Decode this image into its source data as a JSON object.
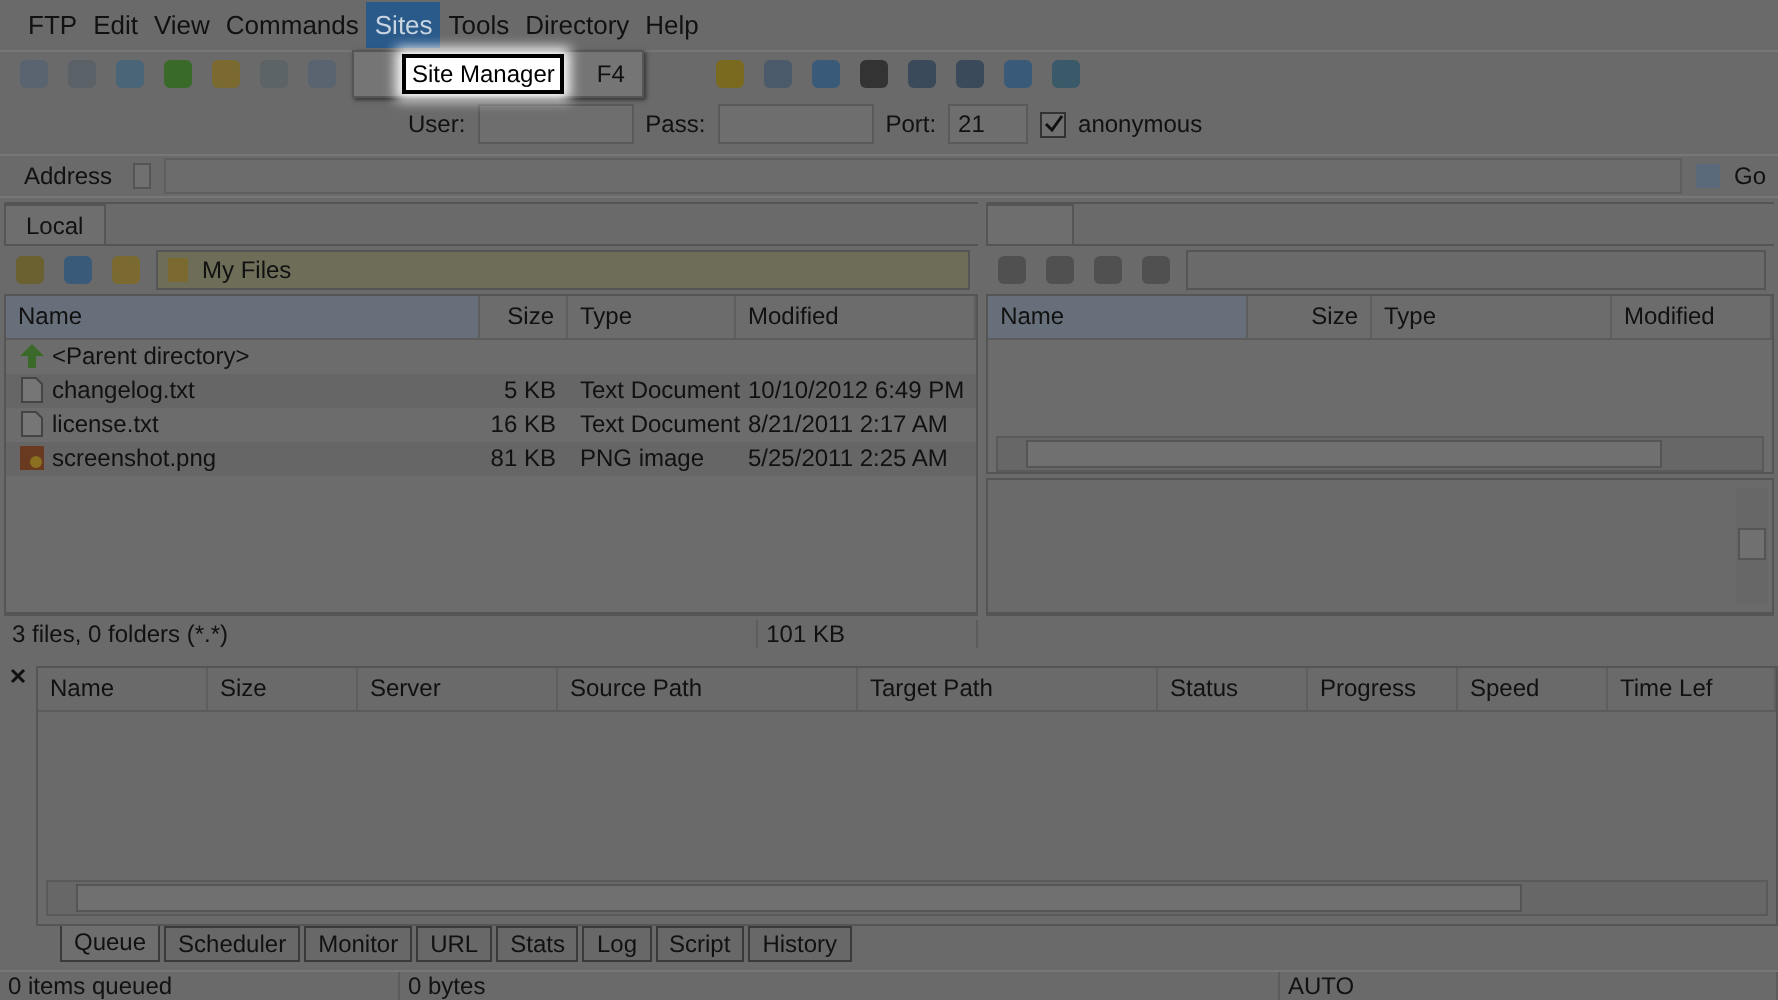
{
  "menu": [
    {
      "label": "FTP",
      "selected": false
    },
    {
      "label": "Edit",
      "selected": false
    },
    {
      "label": "View",
      "selected": false
    },
    {
      "label": "Commands",
      "selected": false
    },
    {
      "label": "Sites",
      "selected": true
    },
    {
      "label": "Tools",
      "selected": false
    },
    {
      "label": "Directory",
      "selected": false
    },
    {
      "label": "Help",
      "selected": false
    }
  ],
  "menu_popup": {
    "items": [
      {
        "label": "Site Manager",
        "shortcut": "F4",
        "selected": true
      }
    ]
  },
  "connection": {
    "user_label": "User:",
    "pass_label": "Pass:",
    "port_label": "Port:",
    "port": "21",
    "anonymous_label": "anonymous",
    "anonymous": true
  },
  "address": {
    "label": "Address",
    "go": "Go"
  },
  "local": {
    "tab": "Local",
    "path": "My Files",
    "columns": [
      "Name",
      "Size",
      "Type",
      "Modified"
    ],
    "rows": [
      {
        "kind": "parent",
        "name": "<Parent directory>",
        "size": "",
        "type": "",
        "modified": ""
      },
      {
        "kind": "text",
        "name": "changelog.txt",
        "size": "5 KB",
        "type": "Text Document",
        "modified": "10/10/2012 6:49 PM"
      },
      {
        "kind": "text",
        "name": "license.txt",
        "size": "16 KB",
        "type": "Text Document",
        "modified": "8/21/2011 2:17 AM"
      },
      {
        "kind": "image",
        "name": "screenshot.png",
        "size": "81 KB",
        "type": "PNG image",
        "modified": "5/25/2011 2:25 AM"
      }
    ],
    "status": "3 files, 0 folders (*.*)",
    "total": "101 KB"
  },
  "remote": {
    "columns": [
      "Name",
      "Size",
      "Type",
      "Modified"
    ]
  },
  "queue": {
    "columns": [
      "Name",
      "Size",
      "Server",
      "Source Path",
      "Target Path",
      "Status",
      "Progress",
      "Speed",
      "Time Lef"
    ],
    "tabs": [
      {
        "label": "Queue",
        "selected": true
      },
      {
        "label": "Scheduler",
        "selected": false
      },
      {
        "label": "Monitor",
        "selected": false
      },
      {
        "label": "URL",
        "selected": false
      },
      {
        "label": "Stats",
        "selected": false
      },
      {
        "label": "Log",
        "selected": false
      },
      {
        "label": "Script",
        "selected": false
      },
      {
        "label": "History",
        "selected": false
      }
    ]
  },
  "status_bar": [
    "0 items queued",
    "0 bytes",
    "AUTO"
  ]
}
